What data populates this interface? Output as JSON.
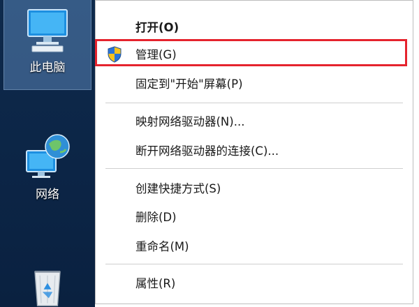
{
  "desktop": {
    "icons": [
      {
        "label": "此电脑",
        "icon": "computer-icon"
      },
      {
        "label": "网络",
        "icon": "network-icon"
      },
      {
        "label": "",
        "icon": "recycle-bin-icon"
      }
    ]
  },
  "context_menu": {
    "items": [
      {
        "label": "打开(O)",
        "bold": true
      },
      {
        "label": "管理(G)",
        "icon": "uac-shield-icon",
        "highlighted": true,
        "highlight_color": "#e5232d"
      },
      {
        "label": "固定到\"开始\"屏幕(P)"
      },
      {
        "label": "映射网络驱动器(N)..."
      },
      {
        "label": "断开网络驱动器的连接(C)..."
      },
      {
        "label": "创建快捷方式(S)"
      },
      {
        "label": "删除(D)"
      },
      {
        "label": "重命名(M)"
      },
      {
        "label": "属性(R)"
      }
    ]
  },
  "colors": {
    "desktop_bg": "#0c2546",
    "selection": "#78aae6",
    "highlight_box": "#e5232d"
  }
}
